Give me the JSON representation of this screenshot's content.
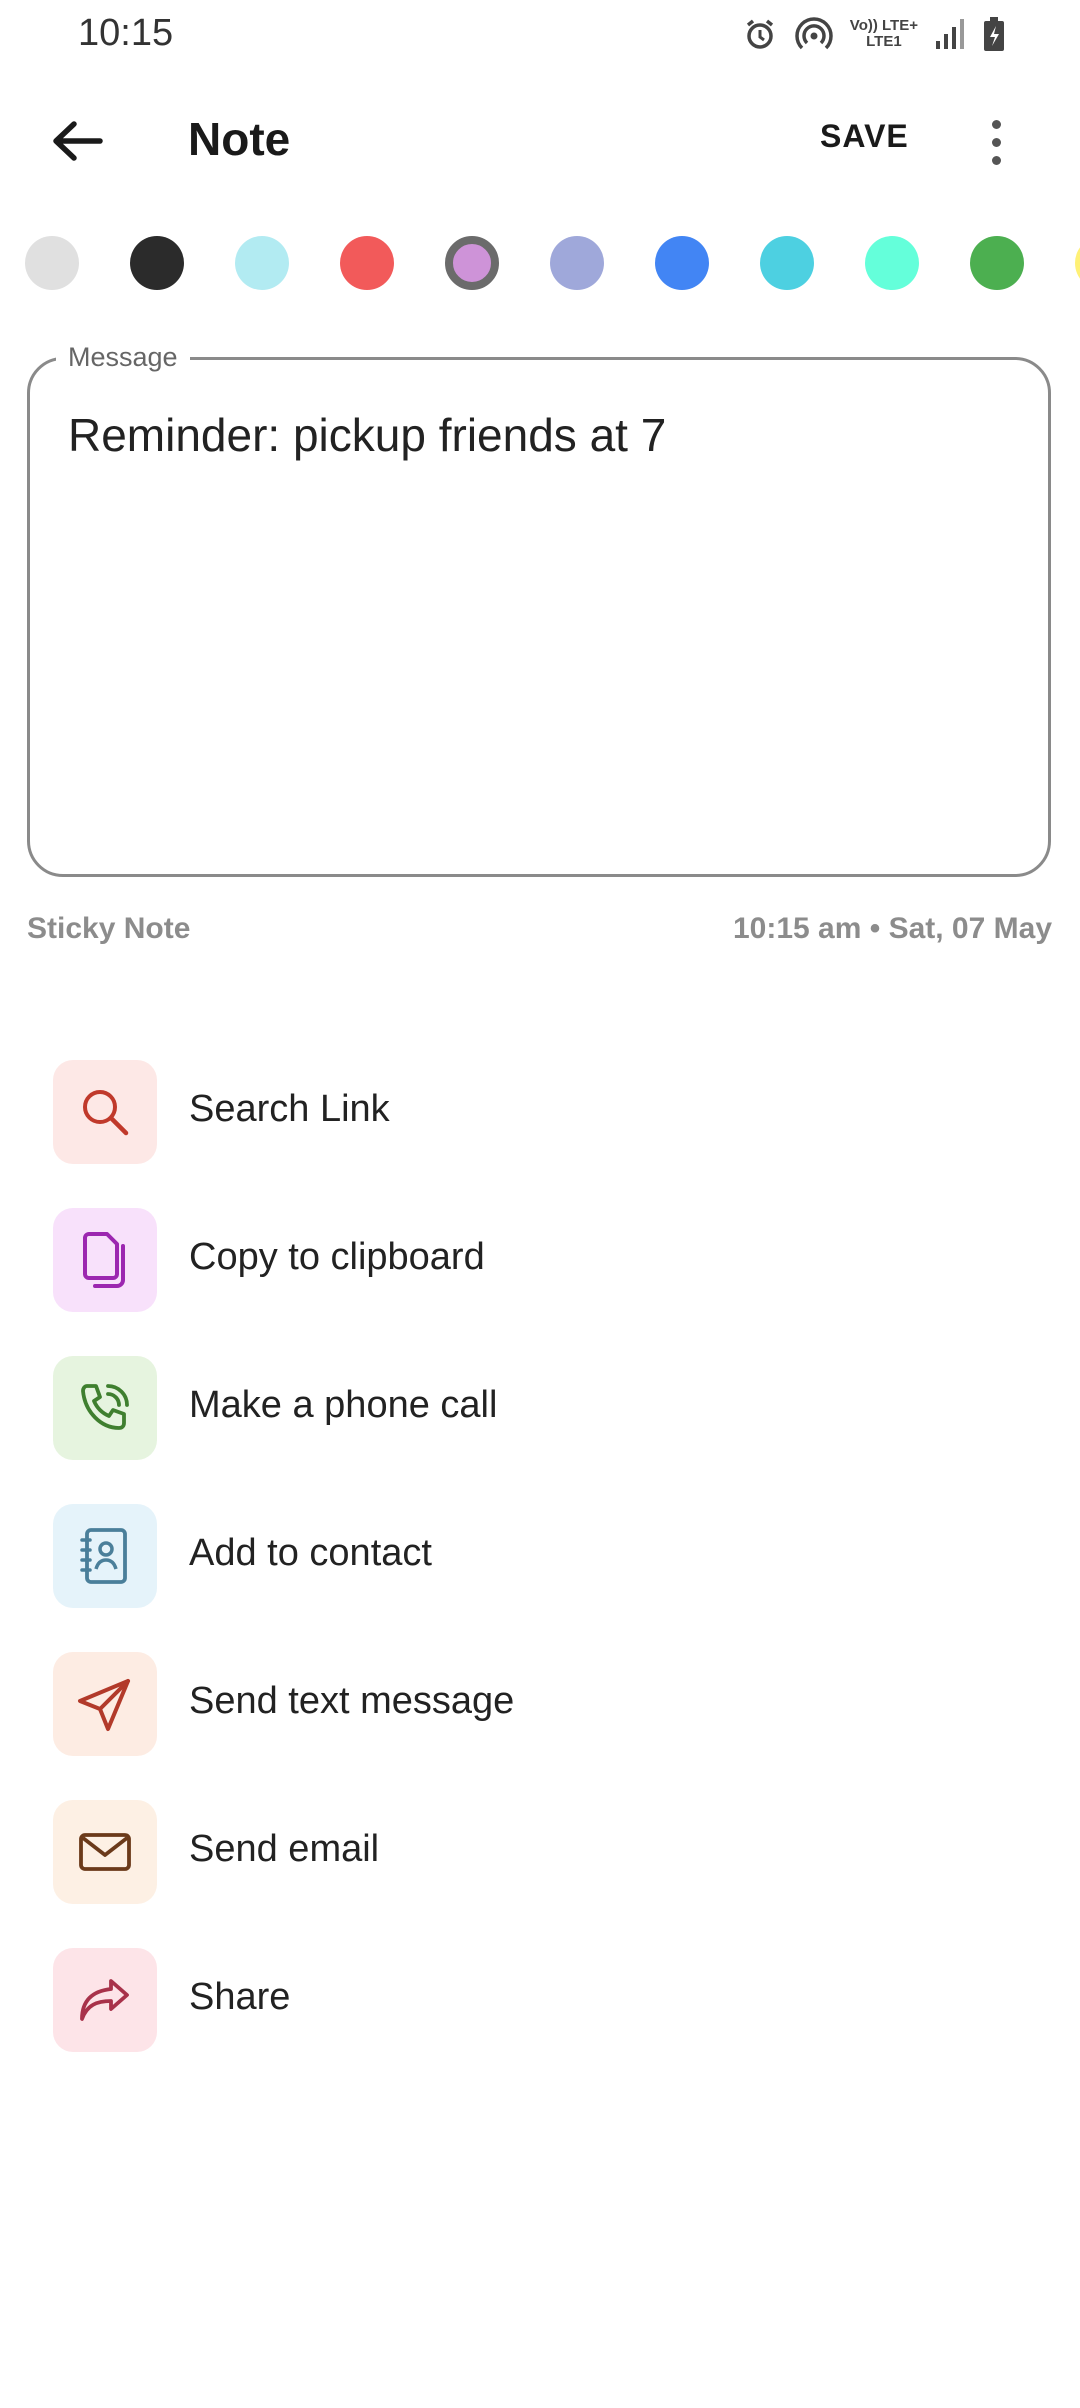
{
  "status_bar": {
    "time": "10:15",
    "icons": [
      "alarm-icon",
      "hotspot-icon",
      "volte-lte-icon",
      "signal-icon",
      "battery-icon"
    ],
    "lte_label_top": "Vo)) LTE+",
    "lte_label_bottom": "LTE1"
  },
  "app_bar": {
    "title": "Note",
    "save_label": "SAVE"
  },
  "colors": [
    "#e0e0e0",
    "#2b2b2b",
    "#b2ebf2",
    "#f25a5a",
    "#ce93d8",
    "#9fa8da",
    "#4285f4",
    "#4dd0e1",
    "#64ffda",
    "#4caf50",
    "#fff176"
  ],
  "selected_color_index": 4,
  "message": {
    "label": "Message",
    "text": "Reminder: pickup friends at 7"
  },
  "footer": {
    "type": "Sticky Note",
    "timestamp": "10:15 am • Sat, 07 May"
  },
  "actions": [
    {
      "label": "Search Link",
      "icon": "search-icon",
      "bg": "#fde8e6",
      "color": "#c0392b"
    },
    {
      "label": "Copy to clipboard",
      "icon": "copy-icon",
      "bg": "#f8e1fb",
      "color": "#9c27b0"
    },
    {
      "label": "Make a phone call",
      "icon": "phone-icon",
      "bg": "#e6f4df",
      "color": "#3f7f2f"
    },
    {
      "label": "Add to contact",
      "icon": "contact-icon",
      "bg": "#e5f3fa",
      "color": "#4a7f9a"
    },
    {
      "label": "Send text message",
      "icon": "send-icon",
      "bg": "#fdece3",
      "color": "#b23a2a"
    },
    {
      "label": "Send email",
      "icon": "email-icon",
      "bg": "#fdf0e4",
      "color": "#6b3a1a"
    },
    {
      "label": "Share",
      "icon": "share-icon",
      "bg": "#fde4e8",
      "color": "#a8324a"
    }
  ]
}
